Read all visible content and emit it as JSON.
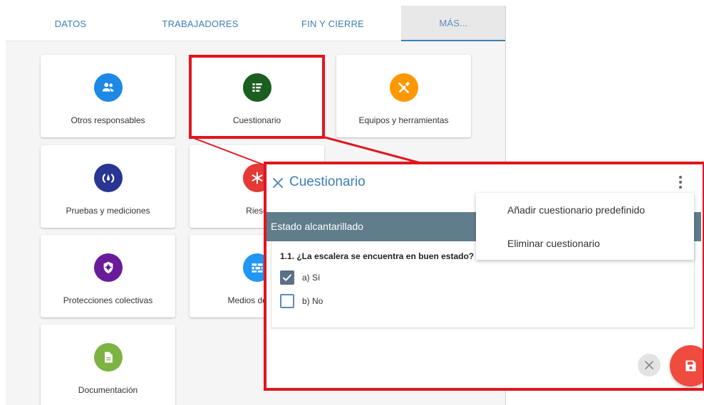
{
  "tabs": [
    {
      "label": "DATOS"
    },
    {
      "label": "TRABAJADORES"
    },
    {
      "label": "FIN Y CIERRE"
    },
    {
      "label": "MÁS..."
    }
  ],
  "active_tab": "MÁS...",
  "tiles": [
    {
      "label": "Otros responsables",
      "icon": "people-icon",
      "color": "#1e88e5"
    },
    {
      "label": "Cuestionario",
      "icon": "list-icon",
      "color": "#1b5e20"
    },
    {
      "label": "Equipos y herramientas",
      "icon": "tools-icon",
      "color": "#ff9800"
    },
    {
      "label": "Pruebas y mediciones",
      "icon": "gauge-icon",
      "color": "#283593"
    },
    {
      "label": "Riesg",
      "icon": "asterisk-icon",
      "color": "#e53935"
    },
    {
      "label": "Protecciones colectivas",
      "icon": "shield-icon",
      "color": "#6a1b9a"
    },
    {
      "label": "Medios de auto",
      "icon": "brick-wall-icon",
      "color": "#2196f3"
    },
    {
      "label": "Documentación",
      "icon": "document-icon",
      "color": "#7cb342"
    }
  ],
  "dialog": {
    "title": "Cuestionario",
    "section_title": "Estado alcantarillado",
    "question": "1.1. ¿La escalera se encuentra en buen estado?",
    "options": [
      {
        "label": "a) Sí",
        "checked": true
      },
      {
        "label": "b) No",
        "checked": false
      }
    ],
    "menu_items": [
      {
        "label": "Añadir cuestionario predefinido"
      },
      {
        "label": "Eliminar cuestionario"
      }
    ]
  },
  "colors": {
    "accent": "#3d7fb6",
    "highlight": "#e0161f",
    "section_band": "#607d8b",
    "save_fab": "#ef4b3e"
  }
}
